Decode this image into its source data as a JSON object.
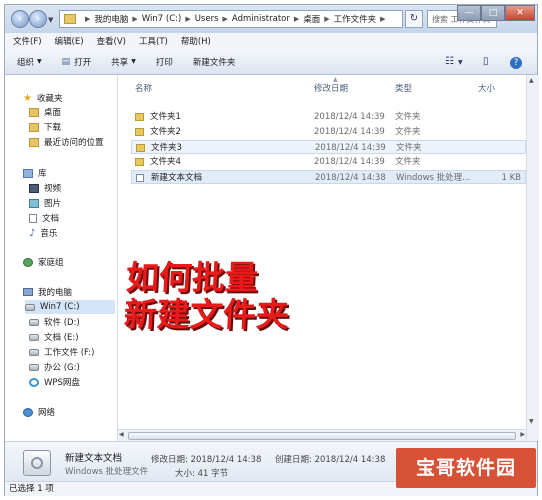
{
  "window": {
    "address": [
      "我的电脑",
      "Win7 (C:)",
      "Users",
      "Administrator",
      "桌面",
      "工作文件夹"
    ],
    "search_placeholder": "搜索 工作文件夹",
    "controls": {
      "min": "—",
      "max": "□",
      "close": "✕"
    }
  },
  "menu": [
    "文件(F)",
    "编辑(E)",
    "查看(V)",
    "工具(T)",
    "帮助(H)"
  ],
  "toolbar": {
    "organize": "组织",
    "open": "打开",
    "share": "共享",
    "print": "打印",
    "new_folder": "新建文件夹"
  },
  "nav": {
    "favorites": "收藏夹",
    "desktop": "桌面",
    "downloads": "下载",
    "recent": "最近访问的位置",
    "libraries": "库",
    "videos": "视频",
    "pictures": "图片",
    "documents": "文档",
    "music": "音乐",
    "homegroup": "家庭组",
    "computer": "我的电脑",
    "drive_c": "Win7 (C:)",
    "drive_d": "软件 (D:)",
    "drive_e": "文档 (E:)",
    "drive_f": "工作文件 (F:)",
    "drive_g": "办公 (G:)",
    "wps": "WPS网盘",
    "network": "网络"
  },
  "columns": {
    "name": "名称",
    "date": "修改日期",
    "type": "类型",
    "size": "大小"
  },
  "files": [
    {
      "name": "文件夹1",
      "date": "2018/12/4 14:39",
      "type": "文件夹",
      "size": ""
    },
    {
      "name": "文件夹2",
      "date": "2018/12/4 14:39",
      "type": "文件夹",
      "size": ""
    },
    {
      "name": "文件夹3",
      "date": "2018/12/4 14:39",
      "type": "文件夹",
      "size": ""
    },
    {
      "name": "文件夹4",
      "date": "2018/12/4 14:39",
      "type": "文件夹",
      "size": ""
    },
    {
      "name": "新建文本文档",
      "date": "2018/12/4 14:38",
      "type": "Windows 批处理...",
      "size": "1 KB"
    }
  ],
  "overlay": {
    "line1": "如何批量",
    "line2": "新建文件夹"
  },
  "details": {
    "name": "新建文本文档",
    "type": "Windows 批处理文件",
    "modified": "修改日期: 2018/12/4 14:38",
    "created": "创建日期: 2018/12/4 14:38",
    "size": "大小: 41 字节"
  },
  "status": "已选择 1 项",
  "watermark": "宝哥软件园"
}
